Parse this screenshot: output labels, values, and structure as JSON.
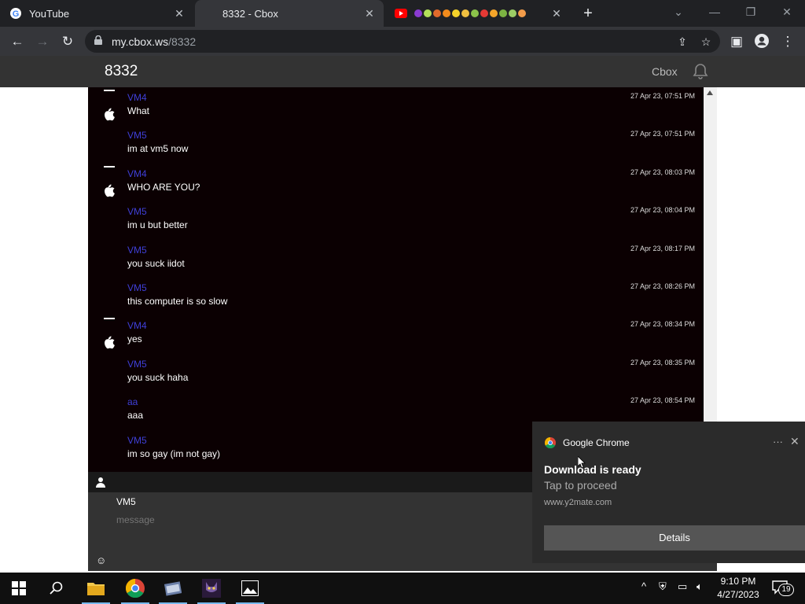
{
  "browser": {
    "tabs": [
      {
        "title": "YouTube",
        "icon": "google-icon"
      },
      {
        "title": "8332 - Cbox",
        "icon": "none"
      },
      {
        "title": "",
        "icon": "youtube-icon"
      }
    ],
    "url_host": "my.cbox.ws",
    "url_path": "/8332"
  },
  "page": {
    "room_title": "8332",
    "cbox_link": "Cbox"
  },
  "messages": [
    {
      "name": "VM4",
      "time": "27 Apr 23, 07:51 PM",
      "text": "What",
      "avatar": true
    },
    {
      "name": "VM5",
      "time": "27 Apr 23, 07:51 PM",
      "text": "im at vm5 now",
      "avatar": false
    },
    {
      "name": "VM4",
      "time": "27 Apr 23, 08:03 PM",
      "text": "WHO ARE YOU?",
      "avatar": true
    },
    {
      "name": "VM5",
      "time": "27 Apr 23, 08:04 PM",
      "text": "im u but better",
      "avatar": false
    },
    {
      "name": "VM5",
      "time": "27 Apr 23, 08:17 PM",
      "text": "you suck iidot",
      "avatar": false
    },
    {
      "name": "VM5",
      "time": "27 Apr 23, 08:26 PM",
      "text": "this computer is so slow",
      "avatar": false
    },
    {
      "name": "VM4",
      "time": "27 Apr 23, 08:34 PM",
      "text": "yes",
      "avatar": true
    },
    {
      "name": "VM5",
      "time": "27 Apr 23, 08:35 PM",
      "text": "you suck haha",
      "avatar": false
    },
    {
      "name": "aa",
      "time": "27 Apr 23, 08:54 PM",
      "text": "aaa",
      "avatar": false
    },
    {
      "name": "VM5",
      "time": "",
      "text": "im so gay (im not gay)",
      "avatar": false
    }
  ],
  "compose": {
    "name": "VM5",
    "placeholder": "message"
  },
  "notification": {
    "app": "Google Chrome",
    "title": "Download is ready",
    "body": "Tap to proceed",
    "source": "www.y2mate.com",
    "button": "Details"
  },
  "taskbar": {
    "time": "9:10 PM",
    "date": "4/27/2023",
    "notification_count": "19"
  },
  "colors": {
    "chat_bg": "#0b0002",
    "username": "#3f3fd8",
    "header_bg": "#333333"
  }
}
